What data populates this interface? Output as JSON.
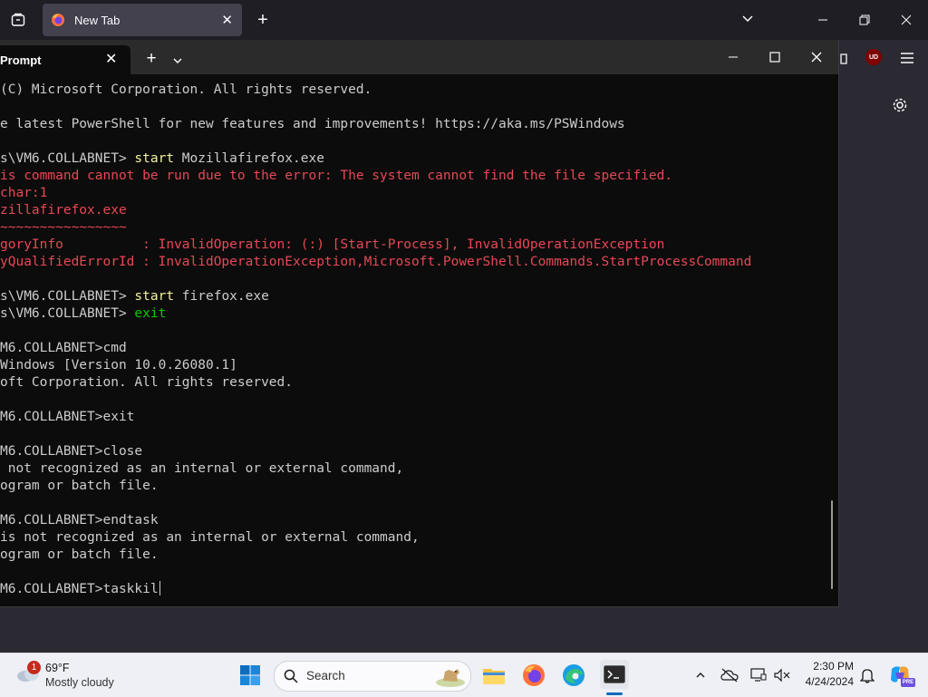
{
  "browser": {
    "tab_title": "New Tab",
    "close_glyph": "✕",
    "new_tab_glyph": "+",
    "list_tabs_glyph": "⌄",
    "minimize_glyph": "—",
    "restore_glyph": "❐",
    "window_close_glyph": "✕",
    "extension_label": "UD"
  },
  "terminal": {
    "tab_title": "Prompt",
    "tab_close_glyph": "✕",
    "new_tab_glyph": "+",
    "dropdown_glyph": "⌄",
    "minimize_glyph": "—",
    "maximize_glyph": "☐",
    "close_glyph": "✕",
    "lines": [
      {
        "segs": [
          {
            "t": "(C) Microsoft Corporation. All rights reserved.",
            "c": "#cccccc"
          }
        ]
      },
      {
        "segs": []
      },
      {
        "segs": [
          {
            "t": "e latest PowerShell for new features and improvements! https://aka.ms/PSWindows",
            "c": "#cccccc"
          }
        ]
      },
      {
        "segs": []
      },
      {
        "segs": [
          {
            "t": "s\\VM6.COLLABNET> ",
            "c": "#cccccc"
          },
          {
            "t": "start",
            "c": "#f2f2a1"
          },
          {
            "t": " Mozillafirefox.exe",
            "c": "#cccccc"
          }
        ]
      },
      {
        "segs": [
          {
            "t": "is command cannot be run due to the error: The system cannot find the file specified.",
            "c": "#e74856"
          }
        ]
      },
      {
        "segs": [
          {
            "t": "char:1",
            "c": "#e74856"
          }
        ]
      },
      {
        "segs": [
          {
            "t": "zillafirefox.exe",
            "c": "#e74856"
          }
        ]
      },
      {
        "segs": [
          {
            "t": "~~~~~~~~~~~~~~~~",
            "c": "#e74856"
          }
        ]
      },
      {
        "segs": [
          {
            "t": "goryInfo          : InvalidOperation: (:) [Start-Process], InvalidOperationException",
            "c": "#e74856"
          }
        ]
      },
      {
        "segs": [
          {
            "t": "yQualifiedErrorId : InvalidOperationException,Microsoft.PowerShell.Commands.StartProcessCommand",
            "c": "#e74856"
          }
        ]
      },
      {
        "segs": []
      },
      {
        "segs": [
          {
            "t": "s\\VM6.COLLABNET> ",
            "c": "#cccccc"
          },
          {
            "t": "start",
            "c": "#f2f2a1"
          },
          {
            "t": " firefox.exe",
            "c": "#cccccc"
          }
        ]
      },
      {
        "segs": [
          {
            "t": "s\\VM6.COLLABNET> ",
            "c": "#cccccc"
          },
          {
            "t": "exit",
            "c": "#16c60c"
          }
        ]
      },
      {
        "segs": []
      },
      {
        "segs": [
          {
            "t": "M6.COLLABNET>cmd",
            "c": "#cccccc"
          }
        ]
      },
      {
        "segs": [
          {
            "t": "Windows [Version 10.0.26080.1]",
            "c": "#cccccc"
          }
        ]
      },
      {
        "segs": [
          {
            "t": "oft Corporation. All rights reserved.",
            "c": "#cccccc"
          }
        ]
      },
      {
        "segs": []
      },
      {
        "segs": [
          {
            "t": "M6.COLLABNET>exit",
            "c": "#cccccc"
          }
        ]
      },
      {
        "segs": []
      },
      {
        "segs": [
          {
            "t": "M6.COLLABNET>close",
            "c": "#cccccc"
          }
        ]
      },
      {
        "segs": [
          {
            "t": " not recognized as an internal or external command,",
            "c": "#cccccc"
          }
        ]
      },
      {
        "segs": [
          {
            "t": "ogram or batch file.",
            "c": "#cccccc"
          }
        ]
      },
      {
        "segs": []
      },
      {
        "segs": [
          {
            "t": "M6.COLLABNET>endtask",
            "c": "#cccccc"
          }
        ]
      },
      {
        "segs": [
          {
            "t": "is not recognized as an internal or external command,",
            "c": "#cccccc"
          }
        ]
      },
      {
        "segs": [
          {
            "t": "ogram or batch file.",
            "c": "#cccccc"
          }
        ]
      },
      {
        "segs": []
      },
      {
        "segs": [
          {
            "t": "M6.COLLABNET>taskkil",
            "c": "#cccccc"
          }
        ]
      }
    ]
  },
  "taskbar": {
    "weather": {
      "temp": "69°F",
      "condition": "Mostly cloudy",
      "badge": "1"
    },
    "search_placeholder": "Search",
    "clock": {
      "time": "2:30 PM",
      "date": "4/24/2024"
    },
    "copilot_badge": "PRE",
    "apps": [
      {
        "name": "start-menu-icon"
      },
      {
        "name": "file-explorer-icon"
      },
      {
        "name": "firefox-icon"
      },
      {
        "name": "edge-icon"
      },
      {
        "name": "terminal-icon"
      }
    ]
  },
  "colors": {
    "terminal_bg": "#0c0c0c",
    "terminal_fg": "#cccccc",
    "error_red": "#e74856",
    "command_yellow": "#f2f2a1",
    "exit_green": "#16c60c",
    "taskbar_bg": "#eef0f5",
    "firefox_bg": "#2b2a33"
  }
}
